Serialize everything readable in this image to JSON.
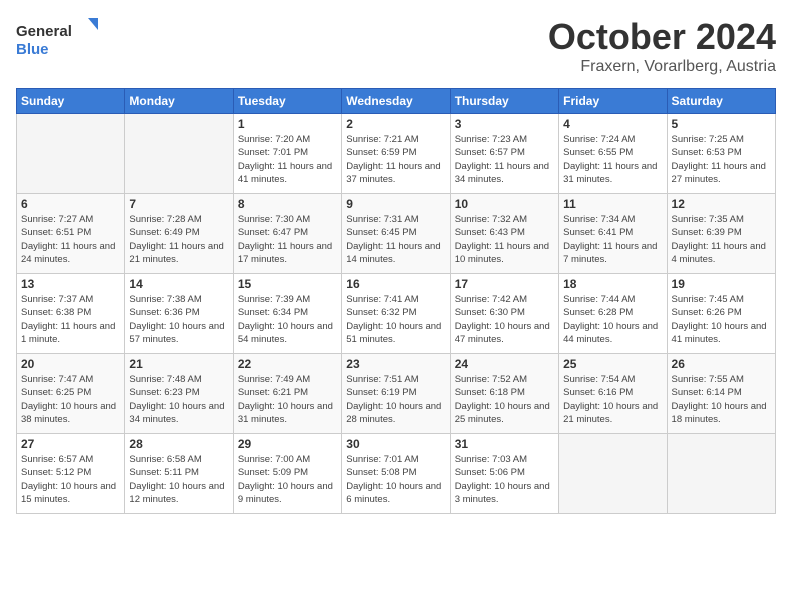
{
  "header": {
    "logo_general": "General",
    "logo_blue": "Blue",
    "month": "October 2024",
    "location": "Fraxern, Vorarlberg, Austria"
  },
  "days_of_week": [
    "Sunday",
    "Monday",
    "Tuesday",
    "Wednesday",
    "Thursday",
    "Friday",
    "Saturday"
  ],
  "weeks": [
    [
      {
        "day": "",
        "empty": true
      },
      {
        "day": "",
        "empty": true
      },
      {
        "day": "1",
        "sunrise": "Sunrise: 7:20 AM",
        "sunset": "Sunset: 7:01 PM",
        "daylight": "Daylight: 11 hours and 41 minutes."
      },
      {
        "day": "2",
        "sunrise": "Sunrise: 7:21 AM",
        "sunset": "Sunset: 6:59 PM",
        "daylight": "Daylight: 11 hours and 37 minutes."
      },
      {
        "day": "3",
        "sunrise": "Sunrise: 7:23 AM",
        "sunset": "Sunset: 6:57 PM",
        "daylight": "Daylight: 11 hours and 34 minutes."
      },
      {
        "day": "4",
        "sunrise": "Sunrise: 7:24 AM",
        "sunset": "Sunset: 6:55 PM",
        "daylight": "Daylight: 11 hours and 31 minutes."
      },
      {
        "day": "5",
        "sunrise": "Sunrise: 7:25 AM",
        "sunset": "Sunset: 6:53 PM",
        "daylight": "Daylight: 11 hours and 27 minutes."
      }
    ],
    [
      {
        "day": "6",
        "sunrise": "Sunrise: 7:27 AM",
        "sunset": "Sunset: 6:51 PM",
        "daylight": "Daylight: 11 hours and 24 minutes."
      },
      {
        "day": "7",
        "sunrise": "Sunrise: 7:28 AM",
        "sunset": "Sunset: 6:49 PM",
        "daylight": "Daylight: 11 hours and 21 minutes."
      },
      {
        "day": "8",
        "sunrise": "Sunrise: 7:30 AM",
        "sunset": "Sunset: 6:47 PM",
        "daylight": "Daylight: 11 hours and 17 minutes."
      },
      {
        "day": "9",
        "sunrise": "Sunrise: 7:31 AM",
        "sunset": "Sunset: 6:45 PM",
        "daylight": "Daylight: 11 hours and 14 minutes."
      },
      {
        "day": "10",
        "sunrise": "Sunrise: 7:32 AM",
        "sunset": "Sunset: 6:43 PM",
        "daylight": "Daylight: 11 hours and 10 minutes."
      },
      {
        "day": "11",
        "sunrise": "Sunrise: 7:34 AM",
        "sunset": "Sunset: 6:41 PM",
        "daylight": "Daylight: 11 hours and 7 minutes."
      },
      {
        "day": "12",
        "sunrise": "Sunrise: 7:35 AM",
        "sunset": "Sunset: 6:39 PM",
        "daylight": "Daylight: 11 hours and 4 minutes."
      }
    ],
    [
      {
        "day": "13",
        "sunrise": "Sunrise: 7:37 AM",
        "sunset": "Sunset: 6:38 PM",
        "daylight": "Daylight: 11 hours and 1 minute."
      },
      {
        "day": "14",
        "sunrise": "Sunrise: 7:38 AM",
        "sunset": "Sunset: 6:36 PM",
        "daylight": "Daylight: 10 hours and 57 minutes."
      },
      {
        "day": "15",
        "sunrise": "Sunrise: 7:39 AM",
        "sunset": "Sunset: 6:34 PM",
        "daylight": "Daylight: 10 hours and 54 minutes."
      },
      {
        "day": "16",
        "sunrise": "Sunrise: 7:41 AM",
        "sunset": "Sunset: 6:32 PM",
        "daylight": "Daylight: 10 hours and 51 minutes."
      },
      {
        "day": "17",
        "sunrise": "Sunrise: 7:42 AM",
        "sunset": "Sunset: 6:30 PM",
        "daylight": "Daylight: 10 hours and 47 minutes."
      },
      {
        "day": "18",
        "sunrise": "Sunrise: 7:44 AM",
        "sunset": "Sunset: 6:28 PM",
        "daylight": "Daylight: 10 hours and 44 minutes."
      },
      {
        "day": "19",
        "sunrise": "Sunrise: 7:45 AM",
        "sunset": "Sunset: 6:26 PM",
        "daylight": "Daylight: 10 hours and 41 minutes."
      }
    ],
    [
      {
        "day": "20",
        "sunrise": "Sunrise: 7:47 AM",
        "sunset": "Sunset: 6:25 PM",
        "daylight": "Daylight: 10 hours and 38 minutes."
      },
      {
        "day": "21",
        "sunrise": "Sunrise: 7:48 AM",
        "sunset": "Sunset: 6:23 PM",
        "daylight": "Daylight: 10 hours and 34 minutes."
      },
      {
        "day": "22",
        "sunrise": "Sunrise: 7:49 AM",
        "sunset": "Sunset: 6:21 PM",
        "daylight": "Daylight: 10 hours and 31 minutes."
      },
      {
        "day": "23",
        "sunrise": "Sunrise: 7:51 AM",
        "sunset": "Sunset: 6:19 PM",
        "daylight": "Daylight: 10 hours and 28 minutes."
      },
      {
        "day": "24",
        "sunrise": "Sunrise: 7:52 AM",
        "sunset": "Sunset: 6:18 PM",
        "daylight": "Daylight: 10 hours and 25 minutes."
      },
      {
        "day": "25",
        "sunrise": "Sunrise: 7:54 AM",
        "sunset": "Sunset: 6:16 PM",
        "daylight": "Daylight: 10 hours and 21 minutes."
      },
      {
        "day": "26",
        "sunrise": "Sunrise: 7:55 AM",
        "sunset": "Sunset: 6:14 PM",
        "daylight": "Daylight: 10 hours and 18 minutes."
      }
    ],
    [
      {
        "day": "27",
        "sunrise": "Sunrise: 6:57 AM",
        "sunset": "Sunset: 5:12 PM",
        "daylight": "Daylight: 10 hours and 15 minutes."
      },
      {
        "day": "28",
        "sunrise": "Sunrise: 6:58 AM",
        "sunset": "Sunset: 5:11 PM",
        "daylight": "Daylight: 10 hours and 12 minutes."
      },
      {
        "day": "29",
        "sunrise": "Sunrise: 7:00 AM",
        "sunset": "Sunset: 5:09 PM",
        "daylight": "Daylight: 10 hours and 9 minutes."
      },
      {
        "day": "30",
        "sunrise": "Sunrise: 7:01 AM",
        "sunset": "Sunset: 5:08 PM",
        "daylight": "Daylight: 10 hours and 6 minutes."
      },
      {
        "day": "31",
        "sunrise": "Sunrise: 7:03 AM",
        "sunset": "Sunset: 5:06 PM",
        "daylight": "Daylight: 10 hours and 3 minutes."
      },
      {
        "day": "",
        "empty": true
      },
      {
        "day": "",
        "empty": true
      }
    ]
  ]
}
